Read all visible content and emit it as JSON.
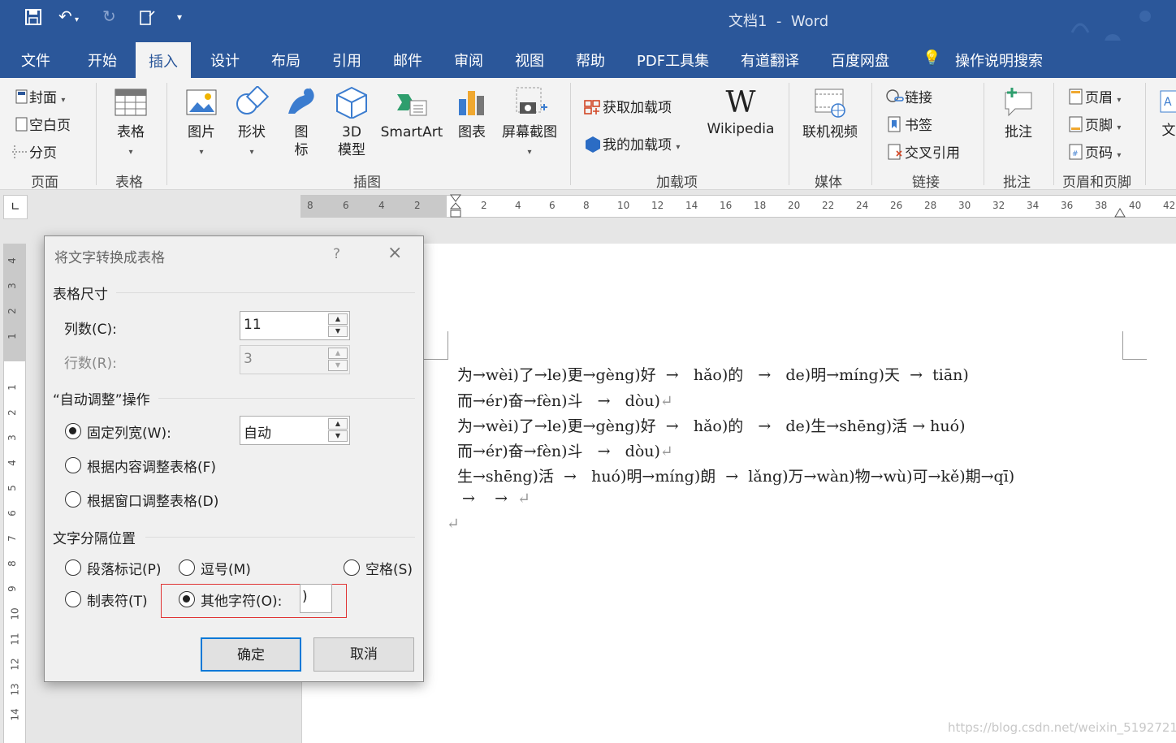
{
  "titlebar": {
    "doc_title": "文档1",
    "separator": "-",
    "app_name": "Word"
  },
  "tabs": [
    "文件",
    "开始",
    "插入",
    "设计",
    "布局",
    "引用",
    "邮件",
    "审阅",
    "视图",
    "帮助",
    "PDF工具集",
    "有道翻译",
    "百度网盘"
  ],
  "tell_me": "操作说明搜索",
  "ribbon": {
    "pages": {
      "cover": "封面",
      "blank": "空白页",
      "break": "分页",
      "group": "页面"
    },
    "tables": {
      "table": "表格",
      "group": "表格"
    },
    "illustrations": {
      "picture": "图片",
      "shapes": "形状",
      "icons1": "图",
      "icons2": "标",
      "model1": "3D",
      "model2": "模型",
      "smartart": "SmartArt",
      "chart": "图表",
      "screenshot": "屏幕截图",
      "group": "插图"
    },
    "addins": {
      "get": "获取加载项",
      "mine": "我的加载项",
      "wikipedia": "Wikipedia",
      "group": "加载项"
    },
    "media": {
      "video": "联机视频",
      "group": "媒体"
    },
    "links": {
      "link": "链接",
      "bookmark": "书签",
      "crossref": "交叉引用",
      "group": "链接"
    },
    "comments": {
      "comment": "批注",
      "group": "批注"
    },
    "headerfooter": {
      "header": "页眉",
      "footer": "页脚",
      "pagenum": "页码",
      "group": "页眉和页脚"
    },
    "text": {
      "label": "文"
    }
  },
  "hruler_ticks": [
    "8",
    "6",
    "4",
    "2",
    "2",
    "4",
    "6",
    "8",
    "10",
    "12",
    "14",
    "16",
    "18",
    "20",
    "22",
    "24",
    "26",
    "28",
    "30",
    "32",
    "34",
    "36",
    "38",
    "40",
    "42"
  ],
  "vruler_ticks": [
    "4",
    "3",
    "2",
    "1",
    "1",
    "2",
    "3",
    "4",
    "5",
    "6",
    "7",
    "8",
    "9",
    "10",
    "11",
    "12",
    "13",
    "14"
  ],
  "document": {
    "lines": [
      "为→wèi)了→le)更→gèng)好  →   hǎo)的   →   de)明→míng)天  →  tiān)",
      "而→ér)奋→fèn)斗   →   dòu)",
      "为→wèi)了→le)更→gèng)好  →   hǎo)的   →   de)生→shēng)活 → huó)",
      "而→ér)奋→fèn)斗   →   dòu)",
      "生→shēng)活  →   huó)明→míng)朗  →  lǎng)万→wàn)物→wù)可→kě)期→qī)",
      " →    →  "
    ],
    "para_mark": "↵"
  },
  "dialog": {
    "title": "将文字转换成表格",
    "help": "?",
    "close": "×",
    "size_section": "表格尺寸",
    "columns_label": "列数(C):",
    "columns_value": "11",
    "rows_label": "行数(R):",
    "rows_value": "3",
    "autofit_section": "“自动调整”操作",
    "fixed_label": "固定列宽(W):",
    "fixed_value": "自动",
    "fit_content": "根据内容调整表格(F)",
    "fit_window": "根据窗口调整表格(D)",
    "separator_section": "文字分隔位置",
    "paragraph": "段落标记(P)",
    "comma": "逗号(M)",
    "space": "空格(S)",
    "tab": "制表符(T)",
    "other": "其他字符(O):",
    "other_value": ")",
    "ok": "确定",
    "cancel": "取消"
  },
  "watermark": "https://blog.csdn.net/weixin_51927215"
}
